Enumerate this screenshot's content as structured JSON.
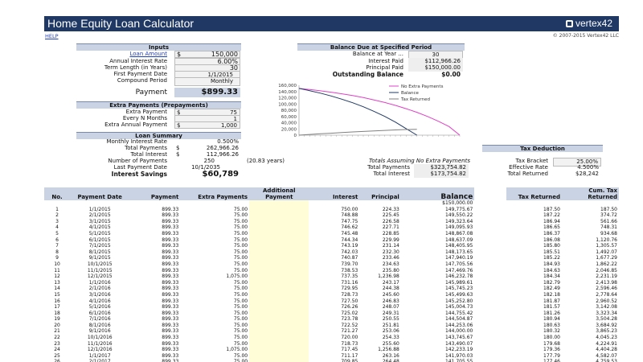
{
  "title": "Home Equity Loan Calculator",
  "logo": "vertex42",
  "help": "HELP",
  "copyright": "© 2007-2015 Vertex42 LLC",
  "inputs": {
    "header": "Inputs",
    "loan_amount_label": "Loan Amount",
    "loan_amount_currency": "$",
    "loan_amount": "150,000",
    "rate_label": "Annual Interest Rate",
    "rate": "6.00%",
    "term_label": "Term Length (in Years)",
    "term": "30",
    "first_payment_label": "First Payment Date",
    "first_payment": "1/1/2015",
    "compound_label": "Compound Period",
    "compound": "Monthly",
    "payment_label": "Payment",
    "payment": "$899.33"
  },
  "extra": {
    "header": "Extra Payments (Prepayments)",
    "extra_payment_label": "Extra Payment",
    "extra_payment_currency": "$",
    "extra_payment": "75",
    "every_label": "Every N Months",
    "every": "1",
    "annual_label": "Extra Annual Payment",
    "annual_currency": "$",
    "annual": "1,000"
  },
  "summary": {
    "header": "Loan Summary",
    "monthly_rate_label": "Monthly Interest Rate",
    "monthly_rate": "0.500%",
    "total_payments_label": "Total Payments",
    "total_payments_currency": "$",
    "total_payments": "262,966.26",
    "total_interest_label": "Total Interest",
    "total_interest_currency": "$",
    "total_interest": "112,966.26",
    "num_payments_label": "Number of Payments",
    "num_payments": "250",
    "num_payments_note": "(20.83 years)",
    "last_payment_label": "Last Payment Date",
    "last_payment": "10/1/2035",
    "savings_label": "Interest Savings",
    "savings": "$60,789"
  },
  "balance_due": {
    "header": "Balance Due at Specified Period",
    "year_label": "Balance at Year ...",
    "year": "30",
    "interest_paid_label": "Interest Paid",
    "interest_paid": "$112,966.26",
    "principal_paid_label": "Principal Paid",
    "principal_paid": "$150,000.00",
    "outstanding_label": "Outstanding Balance",
    "outstanding": "$0.00"
  },
  "no_extra": {
    "header": "Totals Assuming No Extra Payments",
    "total_payments_label": "Total Payments",
    "total_payments": "$323,754.82",
    "total_interest_label": "Total Interest",
    "total_interest": "$173,754.82"
  },
  "tax": {
    "header": "Tax Deduction",
    "bracket_label": "Tax Bracket",
    "bracket": "25.00%",
    "effective_label": "Effective Rate",
    "effective": "4.500%",
    "returned_label": "Total Returned",
    "returned": "$28,242"
  },
  "chart_data": {
    "type": "line",
    "yticks": [
      "160,000",
      "140,000",
      "120,000",
      "100,000",
      "80,000",
      "60,000",
      "40,000",
      "20,000",
      "0"
    ],
    "ylim": [
      0,
      160000
    ],
    "xlim": [
      0,
      30
    ],
    "x": [
      0,
      2,
      4,
      6,
      8,
      10,
      12,
      14,
      16,
      18,
      20,
      22,
      24,
      26,
      28,
      30
    ],
    "legend_position": "top-right",
    "series": [
      {
        "name": "No Extra Payments",
        "color": "#e040c8",
        "values": [
          150000,
          146400,
          142300,
          137700,
          132600,
          126900,
          120400,
          113100,
          104800,
          95500,
          85000,
          73200,
          59800,
          44700,
          27700,
          0
        ]
      },
      {
        "name": "Balance",
        "color": "#1f3864",
        "values": [
          150000,
          142800,
          134700,
          125600,
          115400,
          103900,
          91000,
          76500,
          60100,
          41700,
          21000,
          0,
          null,
          null,
          null,
          null
        ]
      },
      {
        "name": "Tax Returned",
        "color": "#7f7f7f",
        "values": [
          0,
          2200,
          4300,
          6300,
          8300,
          10200,
          12000,
          13700,
          15300,
          16800,
          18000,
          18500,
          null,
          null,
          null,
          null
        ]
      }
    ]
  },
  "table": {
    "headers": [
      "No.",
      "Payment Date",
      "Payment",
      "Extra Payments",
      "Additional Payment",
      "Interest",
      "Principal",
      "Balance",
      "",
      "Tax Returned",
      "Cum. Tax Returned"
    ],
    "start_balance": "$150,000.00",
    "rows": [
      [
        "1",
        "1/1/2015",
        "899.33",
        "75.00",
        "",
        "750.00",
        "224.33",
        "149,775.67",
        "",
        "187.50",
        "187.50"
      ],
      [
        "2",
        "2/1/2015",
        "899.33",
        "75.00",
        "",
        "748.88",
        "225.45",
        "149,550.22",
        "",
        "187.22",
        "374.72"
      ],
      [
        "3",
        "3/1/2015",
        "899.33",
        "75.00",
        "",
        "747.75",
        "226.58",
        "149,323.64",
        "",
        "186.94",
        "561.66"
      ],
      [
        "4",
        "4/1/2015",
        "899.33",
        "75.00",
        "",
        "746.62",
        "227.71",
        "149,095.93",
        "",
        "186.65",
        "748.31"
      ],
      [
        "5",
        "5/1/2015",
        "899.33",
        "75.00",
        "",
        "745.48",
        "228.85",
        "148,867.08",
        "",
        "186.37",
        "934.68"
      ],
      [
        "6",
        "6/1/2015",
        "899.33",
        "75.00",
        "",
        "744.34",
        "229.99",
        "148,637.09",
        "",
        "186.08",
        "1,120.76"
      ],
      [
        "7",
        "7/1/2015",
        "899.33",
        "75.00",
        "",
        "743.19",
        "231.14",
        "148,405.95",
        "",
        "185.80",
        "1,305.57"
      ],
      [
        "8",
        "8/1/2015",
        "899.33",
        "75.00",
        "",
        "742.03",
        "232.30",
        "148,173.65",
        "",
        "185.51",
        "1,492.07"
      ],
      [
        "9",
        "9/1/2015",
        "899.33",
        "75.00",
        "",
        "740.87",
        "233.46",
        "147,940.19",
        "",
        "185.22",
        "1,677.29"
      ],
      [
        "10",
        "10/1/2015",
        "899.33",
        "75.00",
        "",
        "739.70",
        "234.63",
        "147,705.56",
        "",
        "184.93",
        "1,862.22"
      ],
      [
        "11",
        "11/1/2015",
        "899.33",
        "75.00",
        "",
        "738.53",
        "235.80",
        "147,469.76",
        "",
        "184.63",
        "2,046.85"
      ],
      [
        "12",
        "12/1/2015",
        "899.33",
        "1,075.00",
        "",
        "737.35",
        "1,236.98",
        "146,232.78",
        "",
        "184.34",
        "2,231.19"
      ],
      [
        "13",
        "1/1/2016",
        "899.33",
        "75.00",
        "",
        "731.16",
        "243.17",
        "145,989.61",
        "",
        "182.79",
        "2,413.98"
      ],
      [
        "14",
        "2/1/2016",
        "899.33",
        "75.00",
        "",
        "729.95",
        "244.38",
        "145,745.23",
        "",
        "182.49",
        "2,596.46"
      ],
      [
        "15",
        "3/1/2016",
        "899.33",
        "75.00",
        "",
        "728.73",
        "245.60",
        "145,499.63",
        "",
        "182.18",
        "2,778.64"
      ],
      [
        "16",
        "4/1/2016",
        "899.33",
        "75.00",
        "",
        "727.50",
        "246.83",
        "145,252.80",
        "",
        "181.87",
        "2,960.52"
      ],
      [
        "17",
        "5/1/2016",
        "899.33",
        "75.00",
        "",
        "726.26",
        "248.07",
        "145,004.73",
        "",
        "181.57",
        "3,142.08"
      ],
      [
        "18",
        "6/1/2016",
        "899.33",
        "75.00",
        "",
        "725.02",
        "249.31",
        "144,755.42",
        "",
        "181.26",
        "3,323.34"
      ],
      [
        "19",
        "7/1/2016",
        "899.33",
        "75.00",
        "",
        "723.78",
        "250.55",
        "144,504.87",
        "",
        "180.94",
        "3,504.28"
      ],
      [
        "20",
        "8/1/2016",
        "899.33",
        "75.00",
        "",
        "722.52",
        "251.81",
        "144,253.06",
        "",
        "180.63",
        "3,684.92"
      ],
      [
        "21",
        "9/1/2016",
        "899.33",
        "75.00",
        "",
        "721.27",
        "253.06",
        "144,000.00",
        "",
        "180.32",
        "3,865.23"
      ],
      [
        "22",
        "10/1/2016",
        "899.33",
        "75.00",
        "",
        "720.00",
        "254.33",
        "143,745.67",
        "",
        "180.00",
        "4,045.23"
      ],
      [
        "23",
        "11/1/2016",
        "899.33",
        "75.00",
        "",
        "718.73",
        "255.60",
        "143,490.07",
        "",
        "179.68",
        "4,224.91"
      ],
      [
        "24",
        "12/1/2016",
        "899.33",
        "1,075.00",
        "",
        "717.45",
        "1,256.88",
        "142,233.19",
        "",
        "179.36",
        "4,404.28"
      ],
      [
        "25",
        "1/1/2017",
        "899.33",
        "75.00",
        "",
        "711.17",
        "263.16",
        "141,970.03",
        "",
        "177.79",
        "4,582.07"
      ],
      [
        "26",
        "2/1/2017",
        "899.33",
        "75.00",
        "",
        "709.85",
        "264.48",
        "141,705.55",
        "",
        "177.46",
        "4,759.53"
      ],
      [
        "27",
        "3/1/2017",
        "899.33",
        "75.00",
        "",
        "708.53",
        "265.80",
        "141,439.75",
        "",
        "177.13",
        "4,936.66"
      ]
    ]
  }
}
